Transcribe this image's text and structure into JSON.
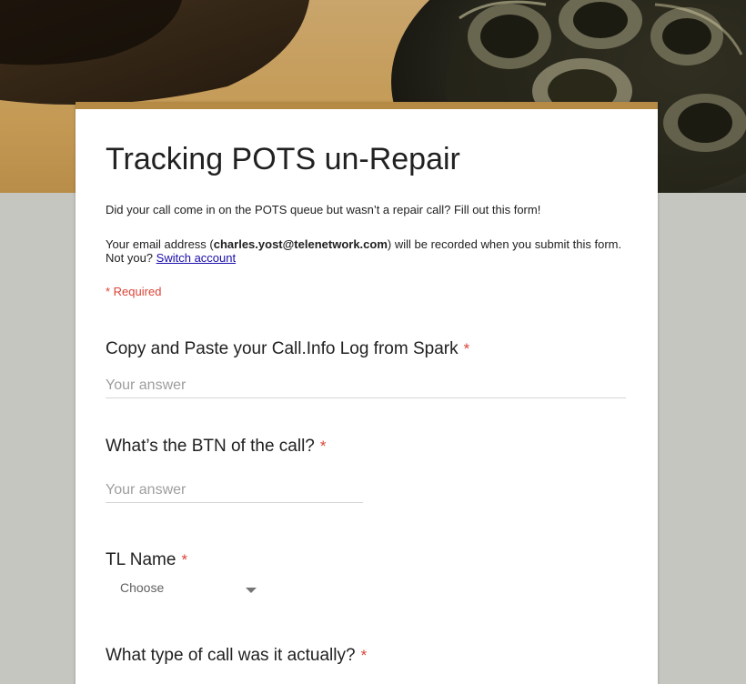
{
  "form": {
    "title": "Tracking POTS un-Repair",
    "description": "Did your call come in on the POTS queue but wasn’t a repair call? Fill out this form!",
    "email_prefix": "Your email address (",
    "email": "charles.yost@telenetwork.com",
    "email_suffix": ") will be recorded when you submit this form.",
    "not_you": "Not you?",
    "switch_account": "Switch account",
    "required_note": "* Required"
  },
  "questions": [
    {
      "title": "Copy and Paste your Call.Info Log from Spark",
      "required_mark": "*",
      "placeholder": "Your answer"
    },
    {
      "title": "What’s the BTN of the call?",
      "required_mark": "*",
      "placeholder": "Your answer"
    },
    {
      "title": "TL Name",
      "required_mark": "*",
      "selected": "Choose"
    },
    {
      "title": "What type of call was it actually?",
      "required_mark": "*"
    }
  ],
  "colors": {
    "accent": "#b48a45",
    "required": "#db4437",
    "link": "#1a0dab",
    "background": "#c5c6c0"
  },
  "icons": {
    "dropdown": "chevron-down-icon",
    "banner": "rotary-phone-image"
  }
}
